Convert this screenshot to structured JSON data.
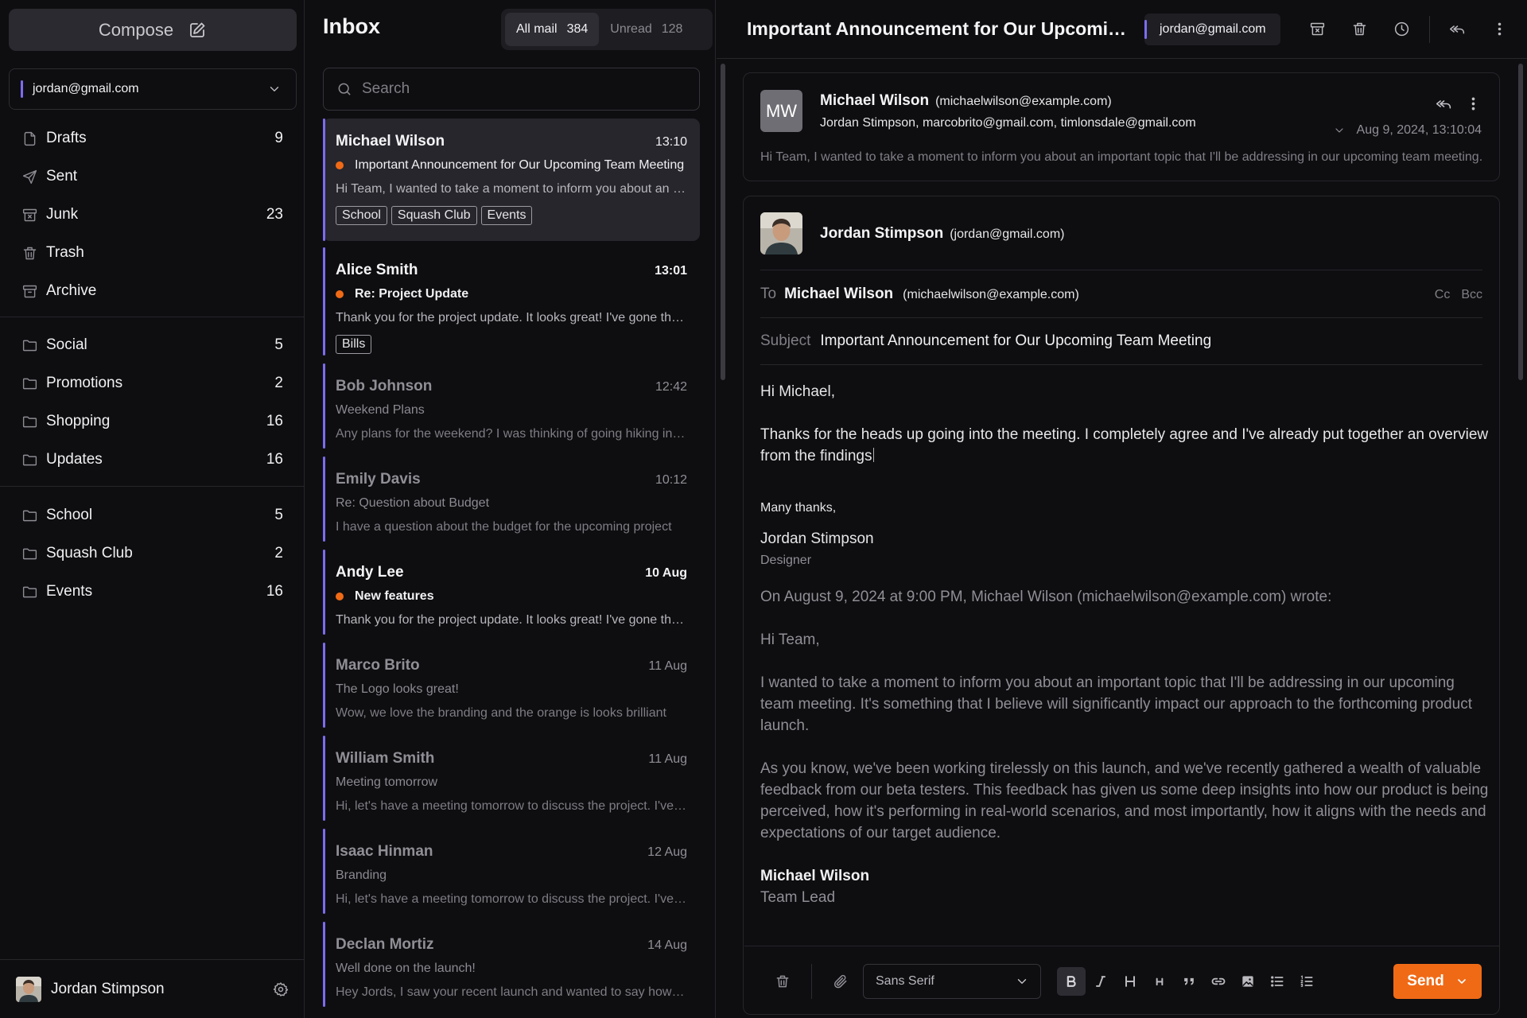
{
  "colors": {
    "accent": "#7c6cf0",
    "send": "#f06a16",
    "unread_dot": "#f06a16",
    "bg": "#0e0e11"
  },
  "sidebar": {
    "compose_label": "Compose",
    "account": "jordan@gmail.com",
    "folders": [
      {
        "label": "Drafts",
        "count": "9",
        "icon": "file-icon"
      },
      {
        "label": "Sent",
        "count": "",
        "icon": "send-icon"
      },
      {
        "label": "Junk",
        "count": "23",
        "icon": "junk-icon"
      },
      {
        "label": "Trash",
        "count": "",
        "icon": "trash-icon"
      },
      {
        "label": "Archive",
        "count": "",
        "icon": "archive-icon"
      }
    ],
    "categories": [
      {
        "label": "Social",
        "count": "5"
      },
      {
        "label": "Promotions",
        "count": "2"
      },
      {
        "label": "Shopping",
        "count": "16"
      },
      {
        "label": "Updates",
        "count": "16"
      }
    ],
    "labels": [
      {
        "label": "School",
        "count": "5"
      },
      {
        "label": "Squash Club",
        "count": "2"
      },
      {
        "label": "Events",
        "count": "16"
      }
    ],
    "user_name": "Jordan Stimpson"
  },
  "inbox": {
    "title": "Inbox",
    "tabs": [
      {
        "label": "All mail",
        "count": "384"
      },
      {
        "label": "Unread",
        "count": "128"
      }
    ],
    "search_placeholder": "Search",
    "messages": [
      {
        "sender": "Michael Wilson",
        "time": "13:10",
        "subject": "Important Announcement for Our Upcoming Team Meeting",
        "preview": "Hi Team, I wanted to take a moment to inform you about an important topic",
        "tags": [
          "School",
          "Squash Club",
          "Events"
        ]
      },
      {
        "sender": "Alice Smith",
        "time": "13:01",
        "subject": "Re: Project Update",
        "preview": "Thank you for the project update. It looks great! I've gone through the report",
        "tags": [
          "Bills"
        ]
      },
      {
        "sender": "Bob Johnson",
        "time": "12:42",
        "subject": "Weekend Plans",
        "preview": "Any plans for the weekend? I was thinking of going hiking in the mountains"
      },
      {
        "sender": "Emily Davis",
        "time": "10:12",
        "subject": "Re: Question about Budget",
        "preview": "I have a question about the budget for the upcoming project"
      },
      {
        "sender": "Andy Lee",
        "time": "10 Aug",
        "subject": "New features",
        "preview": "Thank you for the project update. It looks great! I've gone through the report"
      },
      {
        "sender": "Marco Brito",
        "time": "11 Aug",
        "subject": "The Logo looks great!",
        "preview": "Wow, we love the branding and the orange is looks brilliant"
      },
      {
        "sender": "William Smith",
        "time": "11 Aug",
        "subject": "Meeting tomorrow",
        "preview": "Hi, let's have a meeting tomorrow to discuss the project. I've been reviewing"
      },
      {
        "sender": "Isaac Hinman",
        "time": "12 Aug",
        "subject": "Branding",
        "preview": "Hi, let's have a meeting tomorrow to discuss the project. I've been reviewing"
      },
      {
        "sender": "Declan Mortiz",
        "time": "14 Aug",
        "subject": "Well done on the launch!",
        "preview": "Hey Jords, I saw your recent launch and wanted to say how great it looks"
      }
    ]
  },
  "reader": {
    "title": "Important Announcement for Our Upcoming Team Meeting",
    "account": "jordan@gmail.com",
    "original": {
      "initials": "MW",
      "name": "Michael Wilson",
      "email": "(michaelwilson@example.com)",
      "recipients": "Jordan Stimpson, marcobrito@gmail.com, timlonsdale@gmail.com",
      "date": "Aug 9, 2024, 13:10:04",
      "preview": "Hi Team, I wanted to take a moment to inform you about an important topic that I'll be addressing in our upcoming team meeting."
    },
    "reply": {
      "name": "Jordan Stimpson",
      "email": "(jordan@gmail.com)",
      "to_label": "To",
      "to_name": "Michael Wilson",
      "to_email": "(michaelwilson@example.com)",
      "cc_label": "Cc",
      "bcc_label": "Bcc",
      "subject_label": "Subject",
      "subject": "Important Announcement for Our Upcoming Team Meeting",
      "greeting": "Hi Michael,",
      "body": "Thanks for the heads up going into the meeting. I completely agree and I've already put together an overview from the findings",
      "signoff": "Many thanks,",
      "sig_name": "Jordan Stimpson",
      "sig_role": "Designer",
      "quote_header": "On August 9, 2024 at 9:00 PM, Michael Wilson (michaelwilson@example.com) wrote:",
      "quote_greeting": "Hi Team,",
      "quote_p1": "I wanted to take a moment to inform you about an important topic that I'll be addressing in our upcoming team meeting. It's something that I believe will significantly impact our approach to the forthcoming product launch.",
      "quote_p2": "As you know, we've been working tirelessly on this launch, and we've recently gathered a wealth of valuable feedback from our beta testers. This feedback has given us some deep insights into how our product is being perceived, how it's performing in real-world scenarios, and most importantly, how it aligns with the needs and expectations of our target audience.",
      "quote_sig_name": "Michael Wilson",
      "quote_sig_role": "Team Lead"
    },
    "editor": {
      "font": "Sans Serif",
      "send_label": "Send"
    }
  }
}
